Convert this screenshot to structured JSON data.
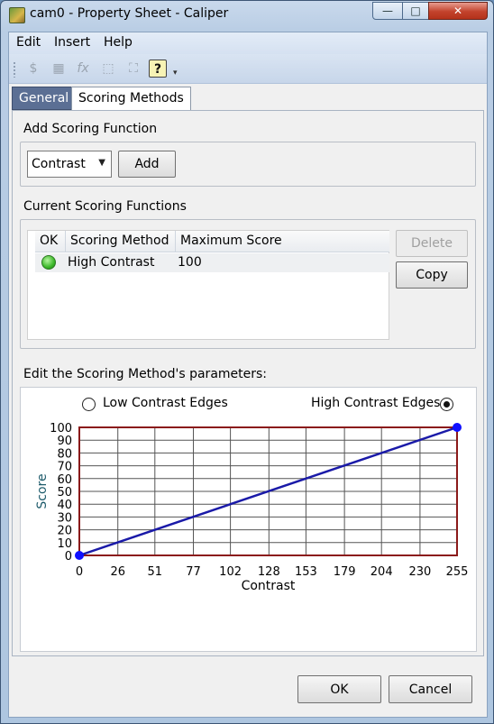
{
  "window": {
    "title": "cam0 - Property Sheet - Caliper",
    "minimize": "—",
    "maximize": "□",
    "close": "✕"
  },
  "menu": [
    "Edit",
    "Insert",
    "Help"
  ],
  "toolbar": {
    "icons": [
      "grip-icon",
      "currency-icon",
      "grid-icon",
      "function-icon",
      "select-icon",
      "fit-icon",
      "help-icon"
    ],
    "more": "▾"
  },
  "tabs": [
    {
      "label": "General",
      "active": false
    },
    {
      "label": "Scoring Methods",
      "active": true
    }
  ],
  "add_section": {
    "title": "Add Scoring Function",
    "combo_value": "Contrast",
    "add_button": "Add"
  },
  "current_section": {
    "title": "Current Scoring Functions",
    "columns": [
      "OK",
      "Scoring Method",
      "Maximum Score"
    ],
    "rows": [
      {
        "ok": true,
        "method": "High Contrast",
        "max_score": "100"
      }
    ],
    "delete_button": "Delete",
    "copy_button": "Copy"
  },
  "params_section": {
    "title": "Edit the Scoring Method's parameters:",
    "radio_low": "Low Contrast Edges",
    "radio_high": "High Contrast Edges",
    "selected": "high"
  },
  "chart_data": {
    "type": "line",
    "xlabel": "Contrast",
    "ylabel": "Score",
    "xlim": [
      0,
      255
    ],
    "ylim": [
      0,
      100
    ],
    "xticks": [
      0,
      26,
      51,
      77,
      102,
      128,
      153,
      179,
      204,
      230,
      255
    ],
    "yticks": [
      0,
      10,
      20,
      30,
      40,
      50,
      60,
      70,
      80,
      90,
      100
    ],
    "grid": true,
    "series": [
      {
        "x": [
          0,
          255
        ],
        "y": [
          0,
          100
        ],
        "color": "#1a1aa8",
        "marker_color": "#1010ff"
      }
    ],
    "frame_color": "#8b1a1a"
  },
  "footer": {
    "ok_button": "OK",
    "cancel_button": "Cancel"
  }
}
